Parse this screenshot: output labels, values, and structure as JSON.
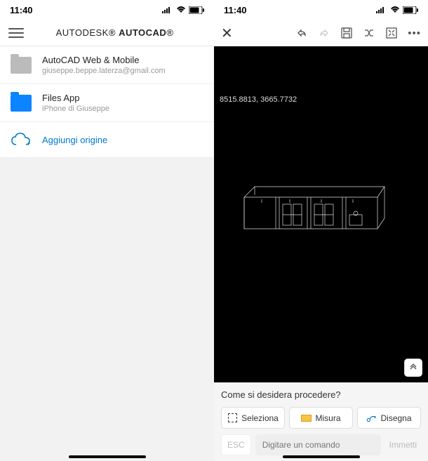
{
  "status": {
    "time": "11:40"
  },
  "left": {
    "brand1": "AUTODESK",
    "brand2": "AUTOCAD",
    "items": [
      {
        "title": "AutoCAD Web & Mobile",
        "subtitle": "giuseppe.beppe.laterza@gmail.com"
      },
      {
        "title": "Files App",
        "subtitle": "iPhone di Giuseppe"
      }
    ],
    "add_origin": "Aggiungi origine"
  },
  "right": {
    "coords": "8515.8813,  3665.7732",
    "prompt": "Come si desidera procedere?",
    "tools": {
      "select": "Seleziona",
      "measure": "Misura",
      "draw": "Disegna"
    },
    "esc": "ESC",
    "cmd_placeholder": "Digitare un comando",
    "submit": "Immetti"
  }
}
